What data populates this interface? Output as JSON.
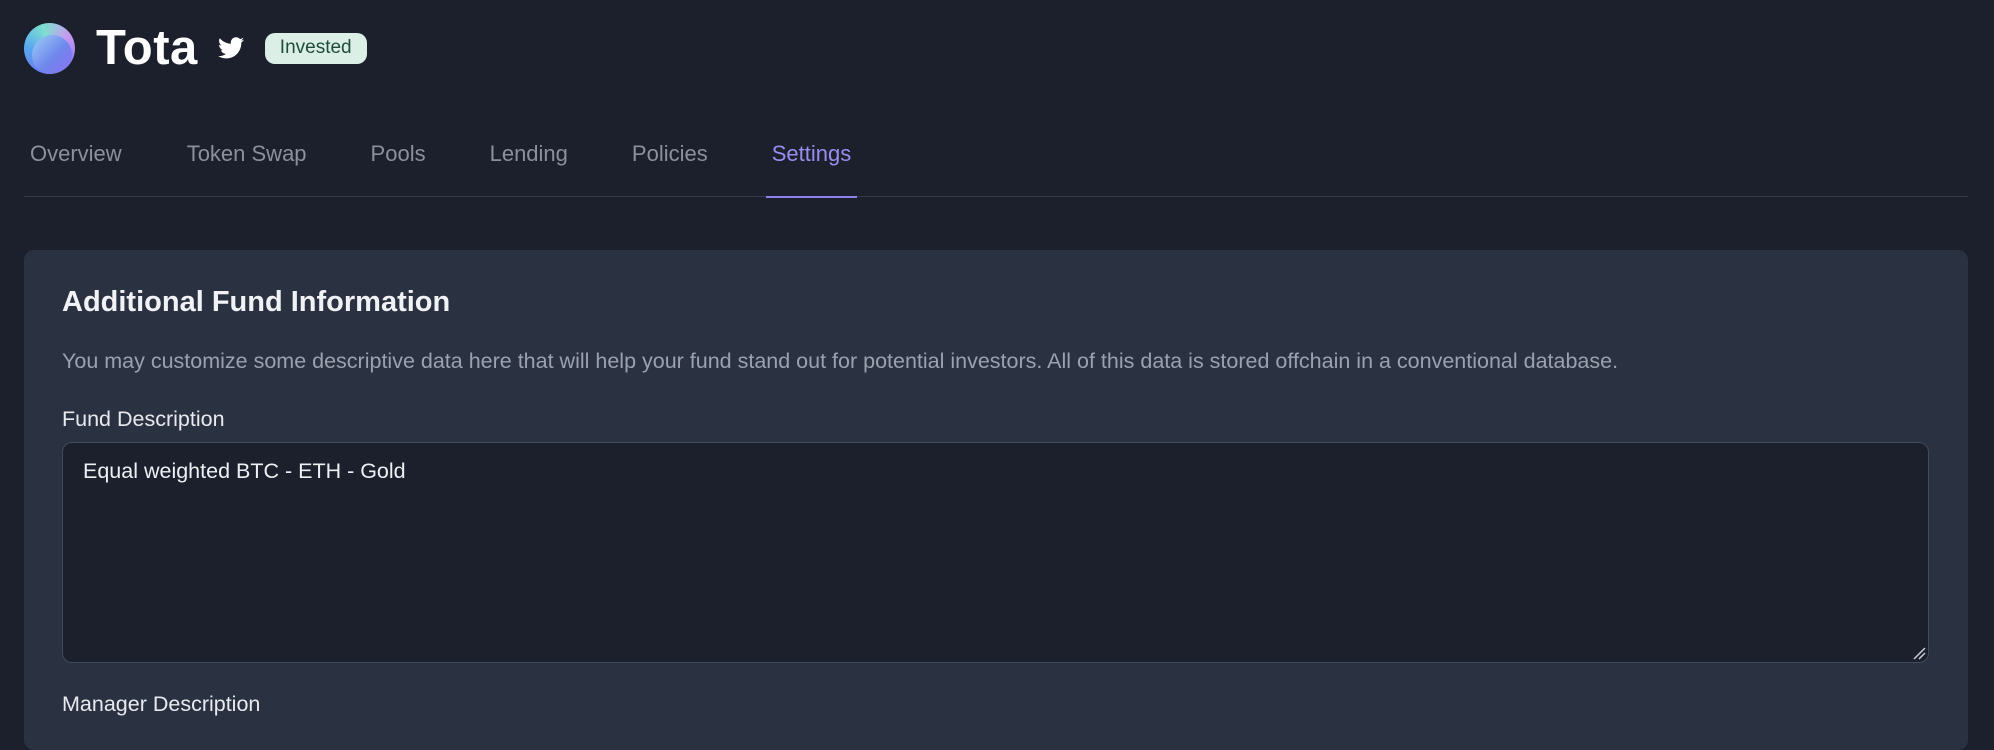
{
  "header": {
    "title": "Tota",
    "badge": "Invested",
    "logo_icon": "fund-logo",
    "social_icon": "twitter-icon"
  },
  "tabs": [
    {
      "label": "Overview",
      "active": false
    },
    {
      "label": "Token Swap",
      "active": false
    },
    {
      "label": "Pools",
      "active": false
    },
    {
      "label": "Lending",
      "active": false
    },
    {
      "label": "Policies",
      "active": false
    },
    {
      "label": "Settings",
      "active": true
    }
  ],
  "settings": {
    "section_title": "Additional Fund Information",
    "section_description": "You may customize some descriptive data here that will help your fund stand out for potential investors. All of this data is stored offchain in a conventional database.",
    "fund_description_label": "Fund Description",
    "fund_description_value": "Equal weighted BTC - ETH - Gold",
    "manager_description_label": "Manager Description"
  },
  "colors": {
    "background": "#1b202c",
    "card": "#2a3140",
    "accent": "#9b8cf0",
    "badge_bg": "#dcefe6"
  }
}
